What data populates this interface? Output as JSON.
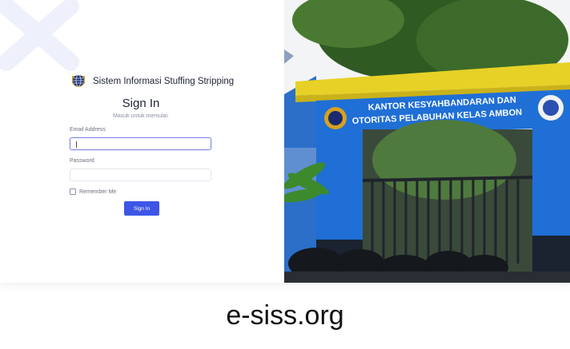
{
  "brand": {
    "name": "Sistem Informasi Stuffing Stripping",
    "logo_icon": "globe-emblem-icon"
  },
  "signin": {
    "title": "Sign In",
    "subtitle": "Masuk untuk memulai.",
    "email_label": "Email Address",
    "email_value": "",
    "password_label": "Password",
    "password_value": "",
    "remember_label": "Remember Me",
    "remember_checked": false,
    "submit_label": "Sign In"
  },
  "photo": {
    "sign_line1": "KANTOR  KESYAHBANDARAN DAN",
    "sign_line2": "OTORITAS PELABUHAN  KELAS AMBON"
  },
  "footer": {
    "site": "e-siss.org"
  },
  "colors": {
    "primary": "#3d56e6",
    "gate_blue": "#1f6fd6",
    "roof_yellow": "#e7d126"
  }
}
